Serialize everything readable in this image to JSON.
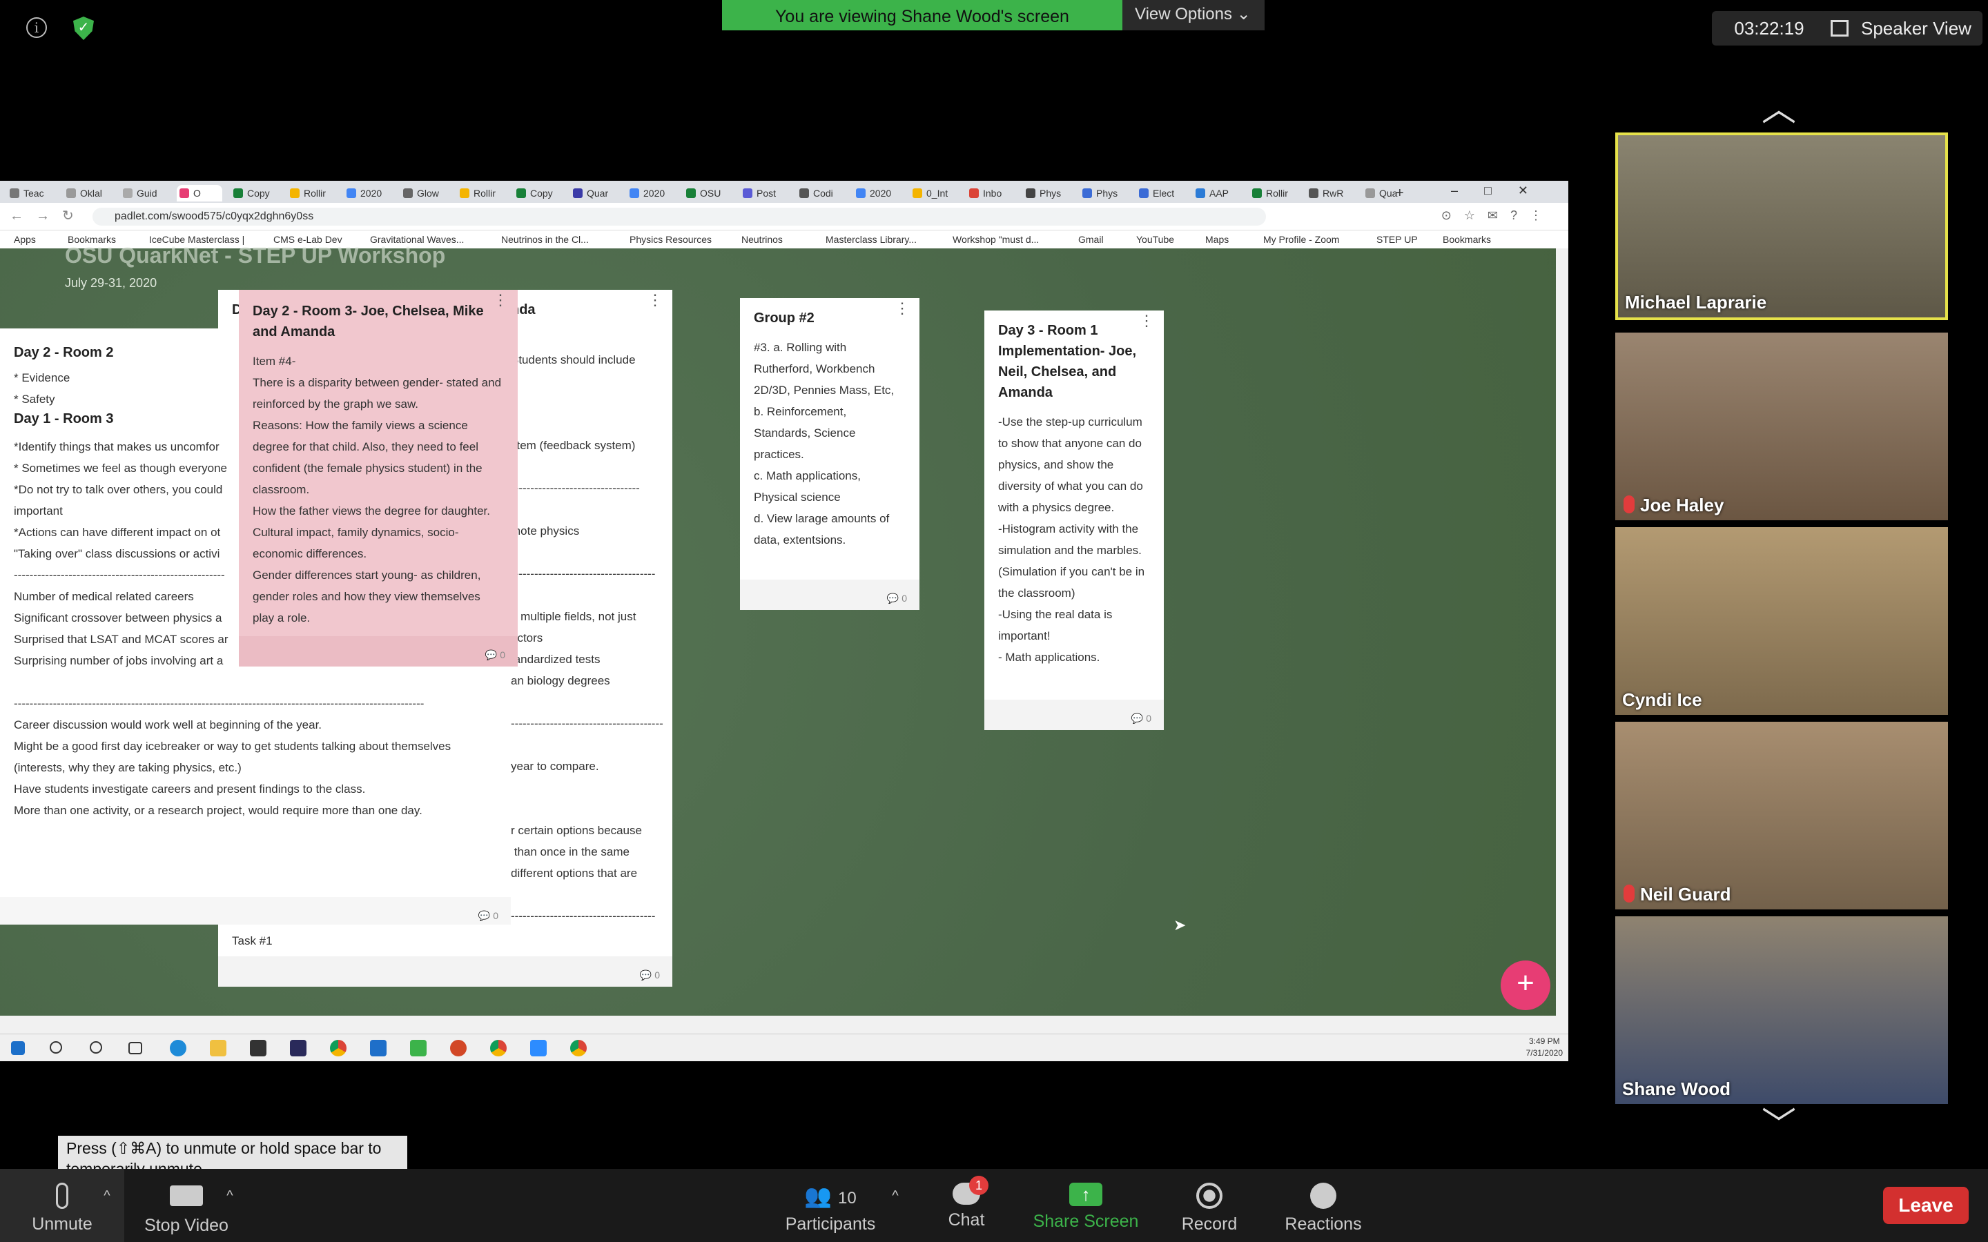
{
  "zoom": {
    "banner": "You are viewing Shane Wood's screen",
    "view_options": "View Options",
    "timer": "03:22:19",
    "speaker_view": "Speaker View",
    "unmute_hint": "Press  (⇧⌘A) to unmute or hold space bar to temporarily unmute.",
    "toolbar": {
      "unmute": "Unmute",
      "stop_video": "Stop Video",
      "participants": "Participants",
      "participants_count": "10",
      "chat": "Chat",
      "chat_badge": "1",
      "share_screen": "Share Screen",
      "record": "Record",
      "reactions": "Reactions",
      "leave": "Leave"
    },
    "participants": [
      {
        "name": "Michael Laprarie",
        "muted": false,
        "active": true
      },
      {
        "name": "Joe Haley",
        "muted": true,
        "active": false
      },
      {
        "name": "Cyndi Ice",
        "muted": false,
        "active": false
      },
      {
        "name": "Neil Guard",
        "muted": true,
        "active": false
      },
      {
        "name": "Shane Wood",
        "muted": false,
        "active": false
      }
    ]
  },
  "browser": {
    "tabs": [
      "Teac",
      "Oklal",
      "Guid",
      "O",
      "Copy",
      "Rollir",
      "2020",
      "Glow",
      "Rollir",
      "Copy",
      "Quar",
      "2020",
      "OSU",
      "Post",
      "Codi",
      "2020",
      "0_Int",
      "Inbo",
      "Phys",
      "Phys",
      "Elect",
      "AAP",
      "Rollir",
      "RwR",
      "Qua"
    ],
    "url": "padlet.com/swood575/c0yqx2dghn6y0ss",
    "bookmarks": [
      "Apps",
      "Bookmarks",
      "IceCube Masterclass |",
      "CMS e-Lab Dev",
      "Gravitational Waves...",
      "Neutrinos in the Cl...",
      "Physics Resources",
      "Neutrinos",
      "Masterclass Library...",
      "Workshop \"must d...",
      "Gmail",
      "YouTube",
      "Maps",
      "My Profile - Zoom",
      "STEP UP",
      "Bookmarks"
    ]
  },
  "padlet": {
    "title": "OSU QuarkNet - STEP UP Workshop",
    "date": "July 29-31, 2020",
    "cards": {
      "left_title_1": "Day 2 - Room 2",
      "left_body_1": "* Evidence\n* Safety",
      "left_title_2": "Day 1 - Room 3",
      "left_body_2": "*Identify things that makes us uncomfor\n* Sometimes we feel as though everyone\n*Do not try to talk over others, you could\nimportant\n*Actions can have different impact on ot\n\"Taking over\" class discussions or activi\n------------------------------------------------------\nNumber of medical related careers\nSignificant crossover between physics a\nSurprised that LSAT and MCAT scores ar\nSurprising number of jobs involving art a\n\n---------------------------------------------------------------------------------------------------------\nCareer discussion would work well at beginning of the year.\nMight be a good first day icebreaker or way to get students talking about themselves\n(interests, why they are taking physics, etc.)\nHave students investigate careers and present findings to the class.\nMore than one activity, or a research project, would require more than one day.",
      "left_count": "0",
      "back_title": "D",
      "back_title_right": "nda",
      "back_body": "Students should include\n\n\n\nstem (feedback system)\n\n---------------------------------\n\nmote physics\n\n-------------------------------------\n\nn multiple fields, not just\noctors\ntandardized tests\nan biology degrees\n\n---------------------------------------\n\nyear to compare.\n\n\nr certain options because\n than once in the same\ndifferent options that are\n\n-------------------------------------",
      "back_footer": "Task #1",
      "back_count": "0",
      "pink_title": "Day 2 - Room 3- Joe, Chelsea, Mike and Amanda",
      "pink_body": "Item #4-\nThere is a disparity between gender- stated and reinforced by the graph we saw.\nReasons: How the family views a science degree for that child. Also, they need to feel confident (the female physics student) in the classroom.\nHow the father views the degree for daughter. Cultural impact, family dynamics, socio-economic differences.\nGender differences start young- as children, gender roles and how they view themselves play a role.",
      "pink_count": "0",
      "group_title": "Group #2",
      "group_body": "#3. a. Rolling with Rutherford, Workbench 2D/3D, Pennies Mass, Etc,\nb. Reinforcement, Standards, Science practices.\nc. Math applications, Physical science\nd. View larage amounts of data, extentsions.",
      "group_count": "0",
      "day3_title": "Day 3 - Room 1 Implementation- Joe, Neil, Chelsea, and Amanda",
      "day3_body": "-Use the step-up curriculum to show that anyone can do physics, and show the diversity of what you can do with a physics degree.\n-Histogram activity with the simulation and the marbles. (Simulation if you can't be in the classroom)\n-Using the real data is important!\n- Math applications.",
      "day3_count": "0"
    }
  },
  "windows": {
    "time": "3:49 PM",
    "date": "7/31/2020"
  }
}
